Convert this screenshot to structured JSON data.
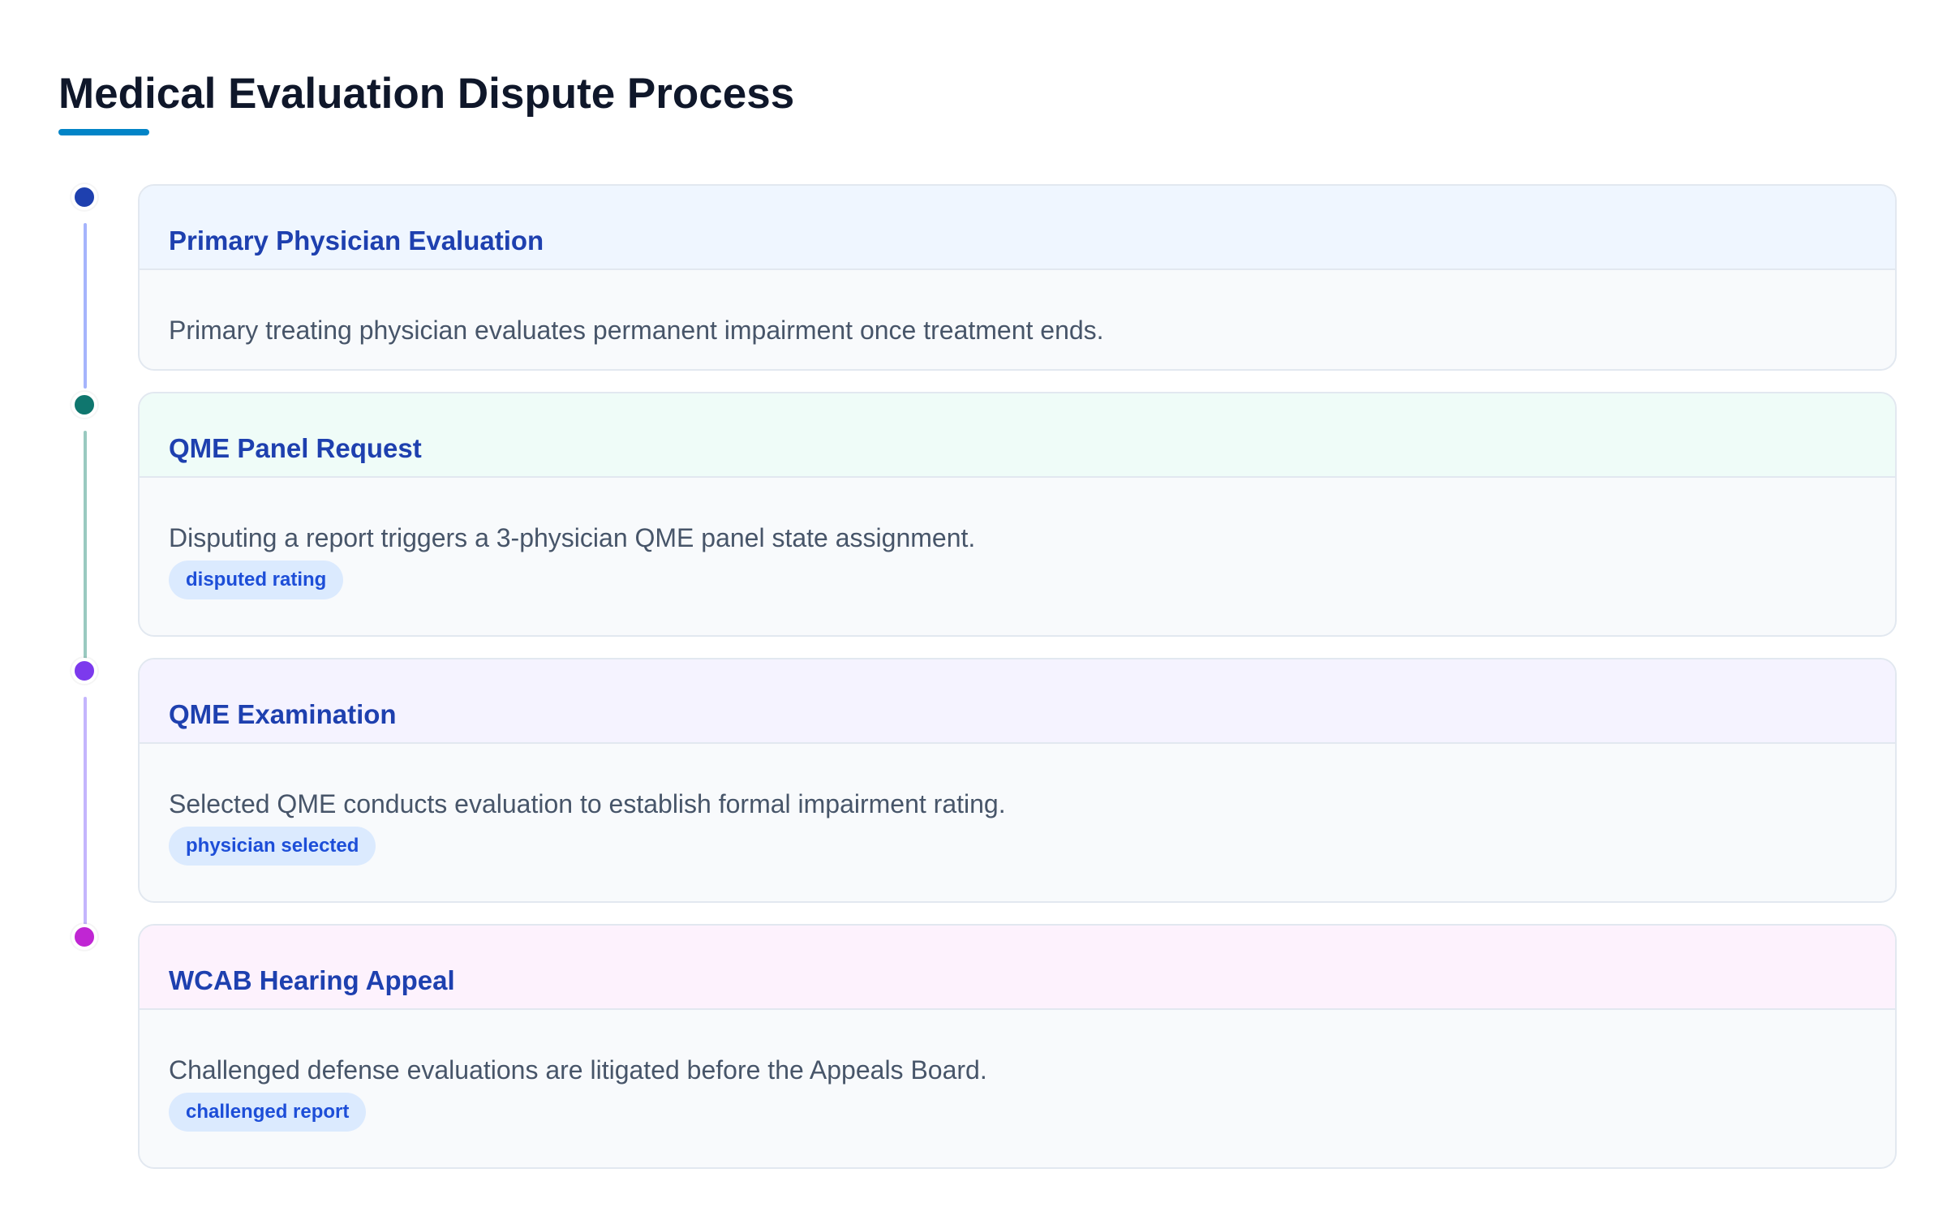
{
  "page": {
    "title": "Medical Evaluation Dispute Process",
    "accent_color": "#0284c7"
  },
  "steps": [
    {
      "title": "Primary Physician Evaluation",
      "description": "Primary treating physician evaluates permanent impairment once treatment ends.",
      "tag": "",
      "dot_color": "#1e40af",
      "line_color": "#a5b4fc",
      "header_bg": "#eff6ff"
    },
    {
      "title": "QME Panel Request",
      "description": "Disputing a report triggers a 3-physician QME panel state assignment.",
      "tag": "disputed rating",
      "dot_color": "#0f766e",
      "line_color": "#99c9c0",
      "header_bg": "#effcf8"
    },
    {
      "title": "QME Examination",
      "description": "Selected QME conducts evaluation to establish formal impairment rating.",
      "tag": "physician selected",
      "dot_color": "#7c3aed",
      "line_color": "#c4b5fd",
      "header_bg": "#f5f3ff"
    },
    {
      "title": "WCAB Hearing Appeal",
      "description": "Challenged defense evaluations are litigated before the Appeals Board.",
      "tag": "challenged report",
      "dot_color": "#c026d3",
      "line_color": "",
      "header_bg": "#fdf2fd"
    }
  ]
}
